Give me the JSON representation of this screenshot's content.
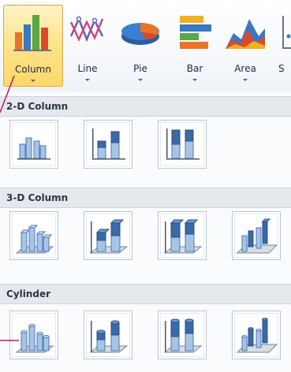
{
  "ribbon": {
    "buttons": [
      {
        "label": "Column",
        "icon": "column-chart-icon",
        "active": true
      },
      {
        "label": "Line",
        "icon": "line-chart-icon"
      },
      {
        "label": "Pie",
        "icon": "pie-chart-icon"
      },
      {
        "label": "Bar",
        "icon": "bar-chart-icon"
      },
      {
        "label": "Area",
        "icon": "area-chart-icon"
      },
      {
        "label": "S",
        "icon": "scatter-chart-icon"
      }
    ]
  },
  "gallery": {
    "sections": [
      {
        "title": "2-D Column",
        "items": [
          "clustered-column",
          "stacked-column",
          "100-stacked-column"
        ]
      },
      {
        "title": "3-D Column",
        "items": [
          "3d-clustered-column",
          "3d-stacked-column",
          "3d-100-stacked-column",
          "3d-column"
        ]
      },
      {
        "title": "Cylinder",
        "items": [
          "clustered-cylinder",
          "stacked-cylinder",
          "100-stacked-cylinder",
          "3d-cylinder"
        ]
      }
    ]
  },
  "colors": {
    "accent": "#fbd86a",
    "callout": "#c2185b",
    "bar_blue": "#4a7ab8"
  }
}
